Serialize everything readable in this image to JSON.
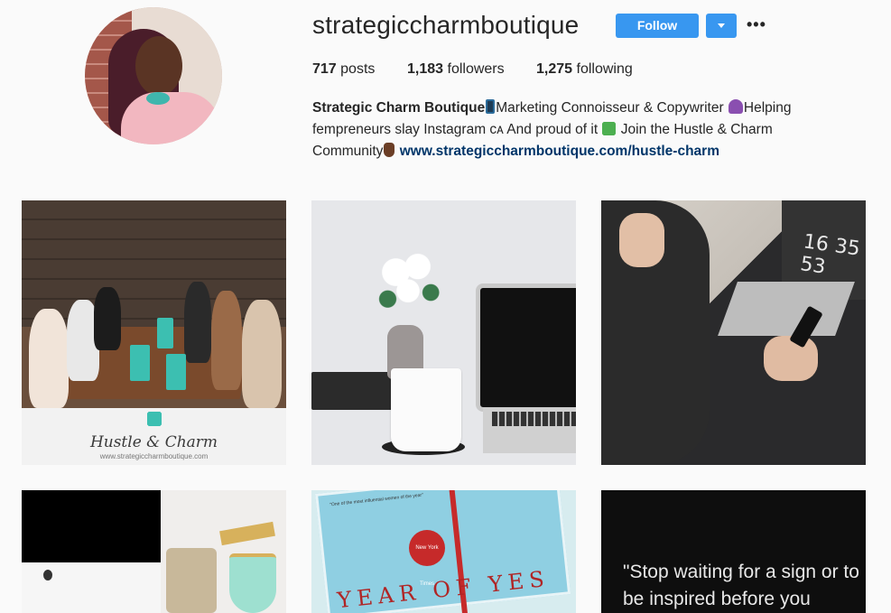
{
  "profile": {
    "username": "strategiccharmboutique",
    "follow_label": "Follow",
    "more_label": "•••",
    "stats": {
      "posts_count": "717",
      "posts_label": "posts",
      "followers_count": "1,183",
      "followers_label": "followers",
      "following_count": "1,275",
      "following_label": "following"
    },
    "bio": {
      "name": "Strategic Charm Boutique",
      "text1": "Marketing Connoisseur & Copywriter",
      "text2": "Helping",
      "text3": "fempreneurs slay Instagram ᴄᴀ And proud of it",
      "text4": "Join the Hustle & Charm",
      "text5": "Community",
      "link": "www.strategiccharmboutique.com/hustle-charm"
    }
  },
  "posts": [
    {
      "brand": "Hustle & Charm",
      "brand_url": "www.strategiccharmboutique.com"
    },
    {},
    {
      "clock": "16 35 53"
    },
    {},
    {
      "tiny": "\"One of the most influential women of the year\"",
      "badge": "New York Times Bestseller",
      "title": "YEAR OF YES"
    },
    {
      "quote": "\"Stop waiting for a sign or to be inspired before you"
    }
  ],
  "colors": {
    "accent": "#3897f0",
    "link": "#003569",
    "text": "#262626",
    "background": "#fafafa"
  }
}
